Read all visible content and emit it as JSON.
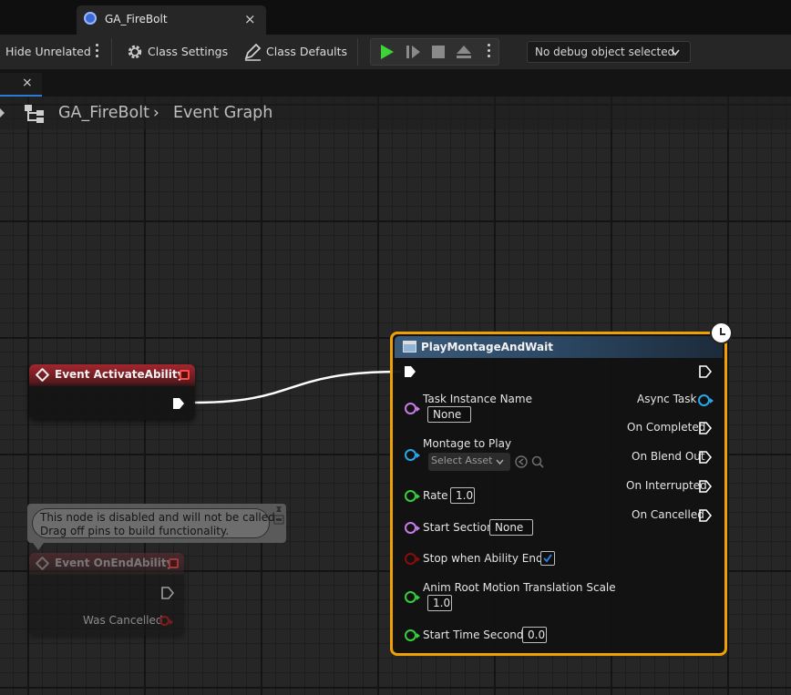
{
  "tab": {
    "title": "GA_FireBolt",
    "close": "×"
  },
  "toolbar": {
    "hide_unrelated": "Hide Unrelated",
    "class_settings": "Class Settings",
    "class_defaults": "Class Defaults",
    "debug_object": "No debug object selected"
  },
  "doc_tab": {
    "close": "×"
  },
  "breadcrumb": {
    "asset": "GA_FireBolt",
    "separator": "›",
    "graph": "Event Graph"
  },
  "nodes": {
    "activate": {
      "title": "Event ActivateAbility"
    },
    "end_ability": {
      "title": "Event OnEndAbility",
      "pin_was_cancelled": "Was Cancelled"
    },
    "disabled_comment": {
      "line1": "This node is disabled and will not be called.",
      "line2": "Drag off pins to build functionality."
    },
    "montage": {
      "title": "PlayMontageAndWait",
      "inputs": {
        "task_instance_name": "Task Instance Name",
        "task_instance_value": "None",
        "montage_to_play": "Montage to Play",
        "montage_placeholder": "Select Asset",
        "rate": "Rate",
        "rate_value": "1.0",
        "start_section": "Start Section",
        "start_section_value": "None",
        "stop_when_ends": "Stop when Ability Ends",
        "anim_root_motion": "Anim Root Motion Translation Scale",
        "anim_root_motion_value": "1.0",
        "start_time": "Start Time Seconds",
        "start_time_value": "0.0"
      },
      "outputs": {
        "async_task": "Async Task",
        "on_completed": "On Completed",
        "on_blend_out": "On Blend Out",
        "on_interrupted": "On Interrupted",
        "on_cancelled": "On Cancelled"
      }
    }
  },
  "colors": {
    "name_pin": "#c77de8",
    "object_pin": "#2aa7ea",
    "float_pin": "#35d13c",
    "bool_pin": "#8a0d0d",
    "selection": "#f0a000",
    "event_header": "#a3262e",
    "play_green": "#3fd33a"
  }
}
